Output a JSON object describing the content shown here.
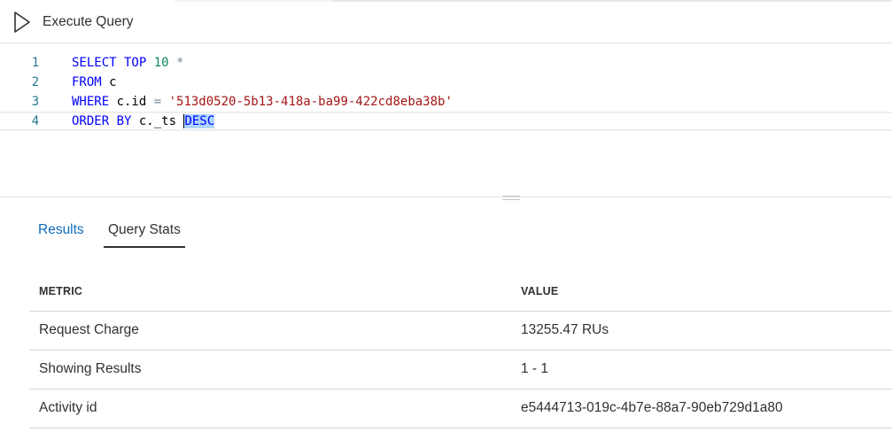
{
  "toolbar": {
    "execute_label": "Execute Query"
  },
  "editor": {
    "lines": [
      {
        "num": "1",
        "parts": [
          [
            "kw",
            "SELECT TOP "
          ],
          [
            "num",
            "10"
          ],
          [
            "op",
            " *"
          ]
        ]
      },
      {
        "num": "2",
        "parts": [
          [
            "kw",
            "FROM "
          ],
          [
            "id",
            "c"
          ]
        ]
      },
      {
        "num": "3",
        "parts": [
          [
            "kw",
            "WHERE "
          ],
          [
            "id",
            "c.id "
          ],
          [
            "op",
            "= "
          ],
          [
            "str",
            "'513d0520-5b13-418a-ba99-422cd8eba38b'"
          ]
        ]
      },
      {
        "num": "4",
        "parts": [
          [
            "kw",
            "ORDER BY "
          ],
          [
            "id",
            "c._ts "
          ],
          [
            "cursor",
            ""
          ],
          [
            "selkw",
            "DESC"
          ]
        ]
      }
    ]
  },
  "tabs": [
    {
      "label": "Results",
      "active": false
    },
    {
      "label": "Query Stats",
      "active": true
    }
  ],
  "stats": {
    "headers": [
      "METRIC",
      "VALUE"
    ],
    "rows": [
      [
        "Request Charge",
        "13255.47 RUs"
      ],
      [
        "Showing Results",
        "1 - 1"
      ],
      [
        "Activity id",
        "e5444713-019c-4b7e-88a7-90eb729d1a80"
      ]
    ]
  },
  "colors": {
    "keyword": "#0000ff",
    "number": "#098658",
    "string": "#a31515",
    "link": "#0f6cbd",
    "line_number": "#237893"
  }
}
